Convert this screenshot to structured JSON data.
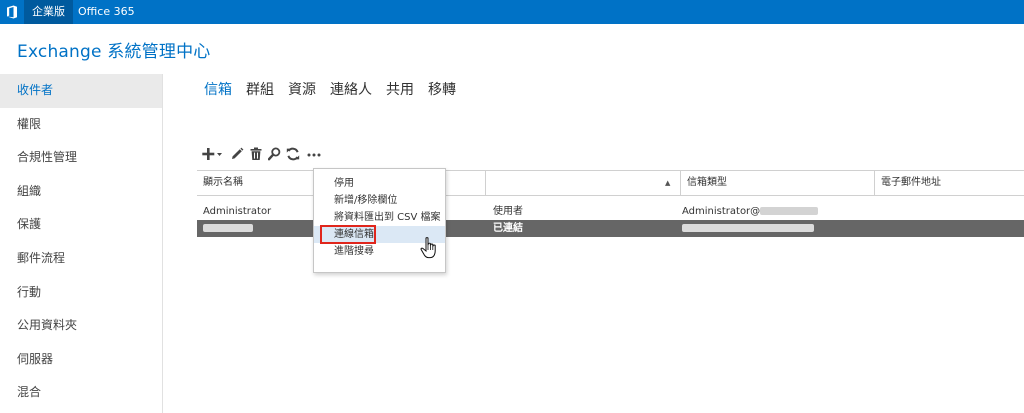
{
  "topbar": {
    "logo_icon": "office-logo-icon",
    "active_tab": "企業版",
    "product_tab": "Office 365",
    "color": "#0072c6"
  },
  "app": {
    "title": "Exchange 系統管理中心"
  },
  "sidebar": {
    "items": [
      {
        "label": "收件者",
        "active": true
      },
      {
        "label": "權限"
      },
      {
        "label": "合規性管理"
      },
      {
        "label": "組織"
      },
      {
        "label": "保護"
      },
      {
        "label": "郵件流程"
      },
      {
        "label": "行動"
      },
      {
        "label": "公用資料夾"
      },
      {
        "label": "伺服器"
      },
      {
        "label": "混合"
      }
    ]
  },
  "subtabs": [
    {
      "label": "信箱",
      "active": true
    },
    {
      "label": "群組"
    },
    {
      "label": "資源"
    },
    {
      "label": "連絡人"
    },
    {
      "label": "共用"
    },
    {
      "label": "移轉"
    }
  ],
  "toolbar": {
    "icons": [
      "add-icon",
      "edit-icon",
      "delete-icon",
      "search-icon",
      "refresh-icon",
      "more-icon"
    ]
  },
  "table": {
    "columns": [
      "顯示名稱",
      "信箱類型",
      "電子郵件地址"
    ],
    "rows": [
      {
        "name": "Administrator",
        "type": "使用者",
        "email": "Administrator@"
      },
      {
        "name": "",
        "type": "已連結",
        "email": "",
        "selected": true
      }
    ]
  },
  "context_menu": {
    "items": [
      {
        "label": "停用"
      },
      {
        "label": "新增/移除欄位"
      },
      {
        "label": "將資料匯出到 CSV 檔案"
      },
      {
        "label": "連線信箱",
        "highlighted": true
      },
      {
        "label": "進階搜尋"
      }
    ],
    "highlight_color": "#e0261c"
  }
}
